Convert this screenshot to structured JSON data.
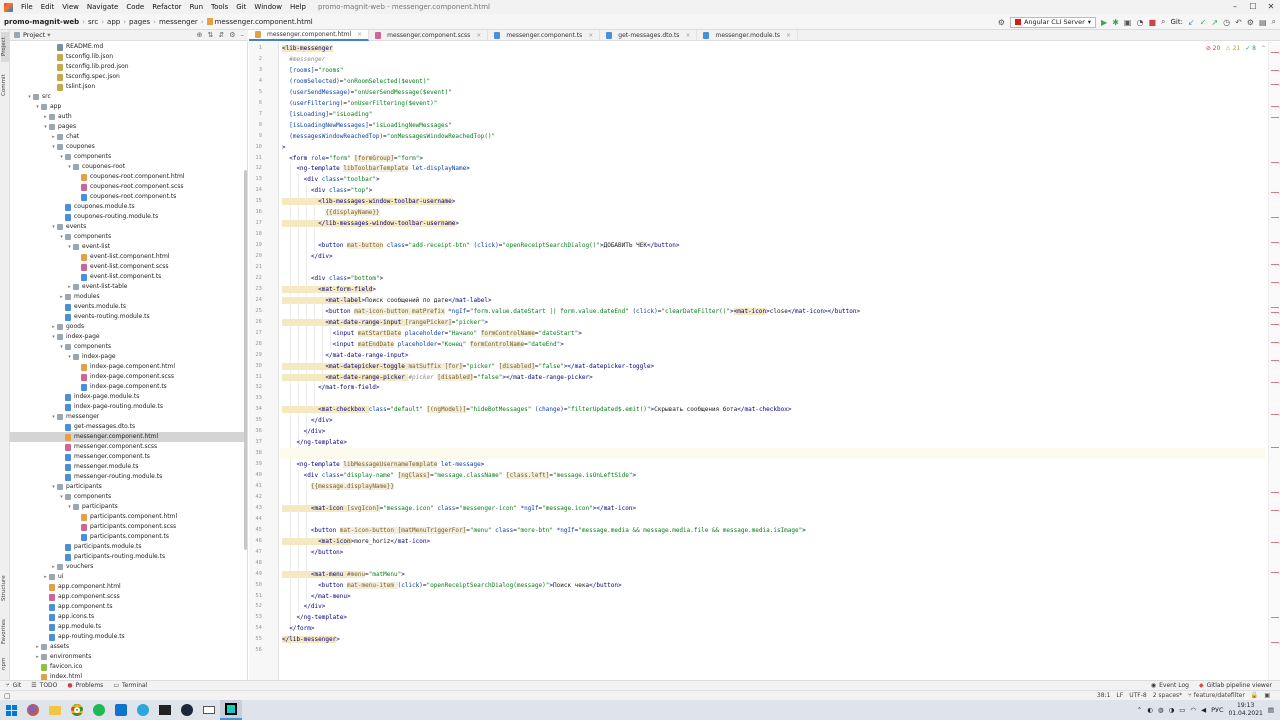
{
  "menu": {
    "items": [
      "File",
      "Edit",
      "View",
      "Navigate",
      "Code",
      "Refactor",
      "Run",
      "Tools",
      "Git",
      "Window",
      "Help"
    ],
    "window_title": "promo-magnit-web - messenger.component.html"
  },
  "breadcrumb": [
    "promo-magnit-web",
    "src",
    "app",
    "pages",
    "messenger",
    "messenger.component.html"
  ],
  "run_config": "Angular CLI Server",
  "git_label": "Git:",
  "project_panel": {
    "title": "Project"
  },
  "tree": [
    {
      "label": "README.md",
      "indent": 5,
      "icon": "md"
    },
    {
      "label": "tsconfig.lib.json",
      "indent": 5,
      "icon": "json"
    },
    {
      "label": "tsconfig.lib.prod.json",
      "indent": 5,
      "icon": "json"
    },
    {
      "label": "tsconfig.spec.json",
      "indent": 5,
      "icon": "json"
    },
    {
      "label": "tslint.json",
      "indent": 5,
      "icon": "json"
    },
    {
      "label": "src",
      "indent": 2,
      "icon": "folder",
      "arrow": "v"
    },
    {
      "label": "app",
      "indent": 3,
      "icon": "folder",
      "arrow": "v"
    },
    {
      "label": "auth",
      "indent": 4,
      "icon": "folder",
      "arrow": ">"
    },
    {
      "label": "pages",
      "indent": 4,
      "icon": "folder",
      "arrow": "v"
    },
    {
      "label": "chat",
      "indent": 5,
      "icon": "folder",
      "arrow": ">"
    },
    {
      "label": "coupones",
      "indent": 5,
      "icon": "folder",
      "arrow": "v"
    },
    {
      "label": "components",
      "indent": 6,
      "icon": "folder",
      "arrow": "v"
    },
    {
      "label": "coupones-root",
      "indent": 7,
      "icon": "folder",
      "arrow": "v"
    },
    {
      "label": "coupones-root.component.html",
      "indent": 8,
      "icon": "html"
    },
    {
      "label": "coupones-root.component.scss",
      "indent": 8,
      "icon": "scss"
    },
    {
      "label": "coupones-root.component.ts",
      "indent": 8,
      "icon": "ts"
    },
    {
      "label": "coupones.module.ts",
      "indent": 6,
      "icon": "ts"
    },
    {
      "label": "coupones-routing.module.ts",
      "indent": 6,
      "icon": "ts"
    },
    {
      "label": "events",
      "indent": 5,
      "icon": "folder",
      "arrow": "v"
    },
    {
      "label": "components",
      "indent": 6,
      "icon": "folder",
      "arrow": "v"
    },
    {
      "label": "event-list",
      "indent": 7,
      "icon": "folder",
      "arrow": "v"
    },
    {
      "label": "event-list.component.html",
      "indent": 8,
      "icon": "html"
    },
    {
      "label": "event-list.component.scss",
      "indent": 8,
      "icon": "scss"
    },
    {
      "label": "event-list.component.ts",
      "indent": 8,
      "icon": "ts"
    },
    {
      "label": "event-list-table",
      "indent": 7,
      "icon": "folder",
      "arrow": ">"
    },
    {
      "label": "modules",
      "indent": 6,
      "icon": "folder",
      "arrow": ">"
    },
    {
      "label": "events.module.ts",
      "indent": 6,
      "icon": "ts"
    },
    {
      "label": "events-routing.module.ts",
      "indent": 6,
      "icon": "ts"
    },
    {
      "label": "goods",
      "indent": 5,
      "icon": "folder",
      "arrow": ">"
    },
    {
      "label": "index-page",
      "indent": 5,
      "icon": "folder",
      "arrow": "v"
    },
    {
      "label": "components",
      "indent": 6,
      "icon": "folder",
      "arrow": "v"
    },
    {
      "label": "index-page",
      "indent": 7,
      "icon": "folder",
      "arrow": "v"
    },
    {
      "label": "index-page.component.html",
      "indent": 8,
      "icon": "html"
    },
    {
      "label": "index-page.component.scss",
      "indent": 8,
      "icon": "scss"
    },
    {
      "label": "index-page.component.ts",
      "indent": 8,
      "icon": "ts"
    },
    {
      "label": "index-page.module.ts",
      "indent": 6,
      "icon": "ts"
    },
    {
      "label": "index-page-routing.module.ts",
      "indent": 6,
      "icon": "ts"
    },
    {
      "label": "messenger",
      "indent": 5,
      "icon": "folder",
      "arrow": "v"
    },
    {
      "label": "get-messages.dto.ts",
      "indent": 6,
      "icon": "ts"
    },
    {
      "label": "messenger.component.html",
      "indent": 6,
      "icon": "html",
      "selected": true
    },
    {
      "label": "messenger.component.scss",
      "indent": 6,
      "icon": "scss"
    },
    {
      "label": "messenger.component.ts",
      "indent": 6,
      "icon": "ts"
    },
    {
      "label": "messenger.module.ts",
      "indent": 6,
      "icon": "ts"
    },
    {
      "label": "messenger-routing.module.ts",
      "indent": 6,
      "icon": "ts"
    },
    {
      "label": "participants",
      "indent": 5,
      "icon": "folder",
      "arrow": "v"
    },
    {
      "label": "components",
      "indent": 6,
      "icon": "folder",
      "arrow": "v"
    },
    {
      "label": "participants",
      "indent": 7,
      "icon": "folder",
      "arrow": "v"
    },
    {
      "label": "participants.component.html",
      "indent": 8,
      "icon": "html"
    },
    {
      "label": "participants.component.scss",
      "indent": 8,
      "icon": "scss"
    },
    {
      "label": "participants.component.ts",
      "indent": 8,
      "icon": "ts"
    },
    {
      "label": "participants.module.ts",
      "indent": 6,
      "icon": "ts"
    },
    {
      "label": "participants-routing.module.ts",
      "indent": 6,
      "icon": "ts"
    },
    {
      "label": "vouchers",
      "indent": 5,
      "icon": "folder",
      "arrow": ">"
    },
    {
      "label": "ui",
      "indent": 4,
      "icon": "folder",
      "arrow": ">"
    },
    {
      "label": "app.component.html",
      "indent": 4,
      "icon": "html"
    },
    {
      "label": "app.component.scss",
      "indent": 4,
      "icon": "scss"
    },
    {
      "label": "app.component.ts",
      "indent": 4,
      "icon": "ts"
    },
    {
      "label": "app.icons.ts",
      "indent": 4,
      "icon": "ts"
    },
    {
      "label": "app.module.ts",
      "indent": 4,
      "icon": "ts"
    },
    {
      "label": "app-routing.module.ts",
      "indent": 4,
      "icon": "ts"
    },
    {
      "label": "assets",
      "indent": 3,
      "icon": "folder",
      "arrow": ">"
    },
    {
      "label": "environments",
      "indent": 3,
      "icon": "folder",
      "arrow": ">"
    },
    {
      "label": "favicon.ico",
      "indent": 3,
      "icon": "ico"
    },
    {
      "label": "index.html",
      "indent": 3,
      "icon": "html"
    }
  ],
  "tabs": [
    {
      "label": "messenger.component.html",
      "icon": "html",
      "active": true
    },
    {
      "label": "messenger.component.scss",
      "icon": "scss"
    },
    {
      "label": "messenger.component.ts",
      "icon": "ts"
    },
    {
      "label": "get-messages.dto.ts",
      "icon": "ts"
    },
    {
      "label": "messenger.module.ts",
      "icon": "ts"
    }
  ],
  "inspections": {
    "errors": "20",
    "warnings": "21",
    "ok": "8"
  },
  "code_lines": [
    [
      [
        "tagh",
        "<lib-messenger"
      ]
    ],
    [
      [
        "com",
        "  #messenger"
      ]
    ],
    [
      [
        "attr",
        "  [rooms]"
      ],
      [
        "",
        "="
      ],
      [
        "str",
        "\"rooms\""
      ]
    ],
    [
      [
        "attr",
        "  (roomSelected)"
      ],
      [
        "",
        "="
      ],
      [
        "str",
        "\"onRoomSelected($event)\""
      ]
    ],
    [
      [
        "attr",
        "  (userSendMessage)"
      ],
      [
        "",
        "="
      ],
      [
        "str",
        "\"onUserSendMessage($event)\""
      ]
    ],
    [
      [
        "attr",
        "  (userFiltering)"
      ],
      [
        "",
        "="
      ],
      [
        "str",
        "\"onUserFiltering($event)\""
      ]
    ],
    [
      [
        "attr",
        "  [isLoading]"
      ],
      [
        "",
        "="
      ],
      [
        "str",
        "\"isLoading\""
      ]
    ],
    [
      [
        "attr",
        "  [isLoadingNewMessages]"
      ],
      [
        "",
        "="
      ],
      [
        "str",
        "\"isLoadingNewMessages\""
      ]
    ],
    [
      [
        "attr",
        "  (messagesWindowReachedTop)"
      ],
      [
        "",
        "="
      ],
      [
        "str",
        "\"onMessagesWindowReachedTop()\""
      ]
    ],
    [
      [
        "tag",
        ">"
      ]
    ],
    [
      [
        "tag",
        "  <form "
      ],
      [
        "attr",
        "role"
      ],
      [
        "",
        "="
      ],
      [
        "str",
        "\"form\" "
      ],
      [
        "ang",
        "[formGroup]"
      ],
      [
        "",
        "="
      ],
      [
        "str",
        "\"form\""
      ],
      [
        "tag",
        ">"
      ]
    ],
    [
      [
        "tag",
        "    <ng-template "
      ],
      [
        "ang",
        "libToolbarTemplate"
      ],
      [
        "attr",
        " let-displayName"
      ],
      [
        "tag",
        ">"
      ]
    ],
    [
      [
        "tag",
        "      <div "
      ],
      [
        "attr",
        "class"
      ],
      [
        "",
        "="
      ],
      [
        "str",
        "\"toolbar\""
      ],
      [
        "tag",
        ">"
      ]
    ],
    [
      [
        "tag",
        "        <div "
      ],
      [
        "attr",
        "class"
      ],
      [
        "",
        "="
      ],
      [
        "str",
        "\"top\""
      ],
      [
        "tag",
        ">"
      ]
    ],
    [
      [
        "tagh",
        "          <lib-messages-window-toolbar-username"
      ],
      [
        "tag",
        ">"
      ]
    ],
    [
      [
        "",
        "            "
      ],
      [
        "ang",
        "{{displayName}}"
      ]
    ],
    [
      [
        "tagh",
        "          </lib-messages-window-toolbar-username"
      ],
      [
        "tag",
        ">"
      ]
    ],
    [
      [
        "",
        ""
      ]
    ],
    [
      [
        "tag",
        "          <button "
      ],
      [
        "ang",
        "mat-button"
      ],
      [
        "attr",
        " class"
      ],
      [
        "",
        "="
      ],
      [
        "str",
        "\"add-receipt-btn\" "
      ],
      [
        "attr",
        "(click)"
      ],
      [
        "",
        "="
      ],
      [
        "str",
        "\"openReceiptSearchDialog()\""
      ],
      [
        "tag",
        ">"
      ],
      [
        "",
        "ДОБАВИТЬ ЧЕК"
      ],
      [
        "tag",
        "</button>"
      ]
    ],
    [
      [
        "tag",
        "        </div>"
      ]
    ],
    [
      [
        "",
        ""
      ]
    ],
    [
      [
        "tag",
        "        <div "
      ],
      [
        "attr",
        "class"
      ],
      [
        "",
        "="
      ],
      [
        "str",
        "\"bottom\""
      ],
      [
        "tag",
        ">"
      ]
    ],
    [
      [
        "tagh",
        "          <mat-form-field"
      ],
      [
        "tag",
        ">"
      ]
    ],
    [
      [
        "tagh",
        "            <mat-label"
      ],
      [
        "tag",
        ">"
      ],
      [
        "",
        "Поиск сообщений по дате"
      ],
      [
        "tag",
        "</mat-label>"
      ]
    ],
    [
      [
        "tag",
        "            <button "
      ],
      [
        "ang",
        "mat-icon-button matPrefix"
      ],
      [
        "attr",
        " *ngIf"
      ],
      [
        "",
        "="
      ],
      [
        "str",
        "\"form.value.dateStart || form.value.dateEnd\" "
      ],
      [
        "attr",
        "(click)"
      ],
      [
        "",
        "="
      ],
      [
        "str",
        "\"clearDateFilter()\""
      ],
      [
        "tag",
        ">"
      ],
      [
        "tagh",
        "<mat-icon"
      ],
      [
        "tag",
        ">"
      ],
      [
        "",
        "close"
      ],
      [
        "tag",
        "</mat-icon></button>"
      ]
    ],
    [
      [
        "tagh",
        "            <mat-date-range-input "
      ],
      [
        "ang",
        "[rangePicker]"
      ],
      [
        "",
        "="
      ],
      [
        "str",
        "\"picker\""
      ],
      [
        "tag",
        ">"
      ]
    ],
    [
      [
        "tag",
        "              <input "
      ],
      [
        "ang",
        "matStartDate"
      ],
      [
        "attr",
        " placeholder"
      ],
      [
        "",
        "="
      ],
      [
        "str",
        "\"Начало\" "
      ],
      [
        "ang",
        "formControlName"
      ],
      [
        "",
        "="
      ],
      [
        "str",
        "\"dateStart\""
      ],
      [
        "tag",
        ">"
      ]
    ],
    [
      [
        "tag",
        "              <input "
      ],
      [
        "ang",
        "matEndDate"
      ],
      [
        "attr",
        " placeholder"
      ],
      [
        "",
        "="
      ],
      [
        "str",
        "\"Конец\" "
      ],
      [
        "ang",
        "formControlName"
      ],
      [
        "",
        "="
      ],
      [
        "str",
        "\"dateEnd\""
      ],
      [
        "tag",
        ">"
      ]
    ],
    [
      [
        "tag",
        "            </mat-date-range-input>"
      ]
    ],
    [
      [
        "tagh",
        "            <mat-datepicker-toggle "
      ],
      [
        "ang",
        "matSuffix "
      ],
      [
        "ang",
        "[for]"
      ],
      [
        "",
        "="
      ],
      [
        "str",
        "\"picker\" "
      ],
      [
        "ang",
        "[disabled]"
      ],
      [
        "",
        "="
      ],
      [
        "str",
        "\"false\""
      ],
      [
        "tag",
        "></mat-datepicker-toggle>"
      ]
    ],
    [
      [
        "tagh",
        "            <mat-date-range-picker "
      ],
      [
        "com",
        "#picker "
      ],
      [
        "ang",
        "[disabled]"
      ],
      [
        "",
        "="
      ],
      [
        "str",
        "\"false\""
      ],
      [
        "tag",
        "></mat-date-range-picker>"
      ]
    ],
    [
      [
        "tag",
        "          </mat-form-field>"
      ]
    ],
    [
      [
        "",
        ""
      ]
    ],
    [
      [
        "tagh",
        "          <mat-checkbox "
      ],
      [
        "attr",
        "class"
      ],
      [
        "",
        "="
      ],
      [
        "str",
        "\"default\" "
      ],
      [
        "ang",
        "[(ngModel)]"
      ],
      [
        "",
        "="
      ],
      [
        "str",
        "\"hideBotMessages\" "
      ],
      [
        "attr",
        "(change)"
      ],
      [
        "",
        "="
      ],
      [
        "str",
        "\"filterUpdated$.emit()\""
      ],
      [
        "tag",
        ">"
      ],
      [
        "",
        "Скрывать сообщения бота"
      ],
      [
        "tag",
        "</mat-checkbox>"
      ]
    ],
    [
      [
        "tag",
        "        </div>"
      ]
    ],
    [
      [
        "tag",
        "      </div>"
      ]
    ],
    [
      [
        "tag",
        "    </ng-template>"
      ]
    ],
    [
      [
        "",
        ""
      ]
    ],
    [
      [
        "tag",
        "    <ng-template "
      ],
      [
        "ang",
        "libMessageUsernameTemplate"
      ],
      [
        "attr",
        " let-message"
      ],
      [
        "tag",
        ">"
      ]
    ],
    [
      [
        "tag",
        "      <div "
      ],
      [
        "attr",
        "class"
      ],
      [
        "",
        "="
      ],
      [
        "str",
        "\"display-name\" "
      ],
      [
        "ang",
        "[ngClass]"
      ],
      [
        "",
        "="
      ],
      [
        "str",
        "\"message.className\" "
      ],
      [
        "ang",
        "[class.left]"
      ],
      [
        "",
        "="
      ],
      [
        "str",
        "\"message.isOnLeftSide\""
      ],
      [
        "tag",
        ">"
      ]
    ],
    [
      [
        "",
        "        "
      ],
      [
        "ang",
        "{{message.displayName}}"
      ]
    ],
    [
      [
        "",
        ""
      ]
    ],
    [
      [
        "tagh",
        "        <mat-icon "
      ],
      [
        "ang",
        "[svgIcon]"
      ],
      [
        "",
        "="
      ],
      [
        "str",
        "\"message.icon\" "
      ],
      [
        "attr",
        "class"
      ],
      [
        "",
        "="
      ],
      [
        "str",
        "\"messenger-icon\" "
      ],
      [
        "attr",
        "*ngIf"
      ],
      [
        "",
        "="
      ],
      [
        "str",
        "\"message.icon\""
      ],
      [
        "tag",
        "></mat-icon>"
      ]
    ],
    [
      [
        "",
        ""
      ]
    ],
    [
      [
        "tag",
        "        <button "
      ],
      [
        "ang",
        "mat-icon-button "
      ],
      [
        "ang",
        "[matMenuTriggerFor]"
      ],
      [
        "",
        "="
      ],
      [
        "str",
        "\"menu\" "
      ],
      [
        "attr",
        "class"
      ],
      [
        "",
        "="
      ],
      [
        "str",
        "\"more-btn\" "
      ],
      [
        "attr",
        "*ngIf"
      ],
      [
        "",
        "="
      ],
      [
        "str",
        "\"message.media && message.media.file && message.media.isImage\""
      ],
      [
        "tag",
        ">"
      ]
    ],
    [
      [
        "tagh",
        "          <mat-icon"
      ],
      [
        "tag",
        ">"
      ],
      [
        "",
        "more_horiz"
      ],
      [
        "tag",
        "</mat-icon>"
      ]
    ],
    [
      [
        "tag",
        "        </button>"
      ]
    ],
    [
      [
        "",
        ""
      ]
    ],
    [
      [
        "tagh",
        "        <mat-menu "
      ],
      [
        "ang",
        "#menu"
      ],
      [
        "",
        "="
      ],
      [
        "str",
        "\"matMenu\""
      ],
      [
        "tag",
        ">"
      ]
    ],
    [
      [
        "tag",
        "          <button "
      ],
      [
        "ang",
        "mat-menu-item "
      ],
      [
        "attr",
        "(click)"
      ],
      [
        "",
        "="
      ],
      [
        "str",
        "\"openReceiptSearchDialog(message)\""
      ],
      [
        "tag",
        ">"
      ],
      [
        "",
        "Поиск чека"
      ],
      [
        "tag",
        "</button>"
      ]
    ],
    [
      [
        "tag",
        "        </mat-menu>"
      ]
    ],
    [
      [
        "tag",
        "      </div>"
      ]
    ],
    [
      [
        "tag",
        "    </ng-template>"
      ]
    ],
    [
      [
        "tag",
        "  </form>"
      ]
    ],
    [
      [
        "tagh",
        "</lib-messenger"
      ],
      [
        "tag",
        ">"
      ]
    ],
    [
      [
        "",
        ""
      ]
    ]
  ],
  "tool_windows": [
    "Git",
    "TODO",
    "Problems",
    "Terminal"
  ],
  "tool_windows_right": [
    "Event Log",
    "Gitlab pipeline viewer"
  ],
  "vertical_tabs": [
    "Project",
    "Commit",
    "Structure",
    "Favorites",
    "npm"
  ],
  "status": {
    "position": "38:1",
    "line_sep": "LF",
    "encoding": "UTF-8",
    "indent": "2 spaces*",
    "branch": "feature/datefilter"
  },
  "taskbar": {
    "lang": "РУС",
    "time": "19:13",
    "date": "01.04.2021"
  }
}
